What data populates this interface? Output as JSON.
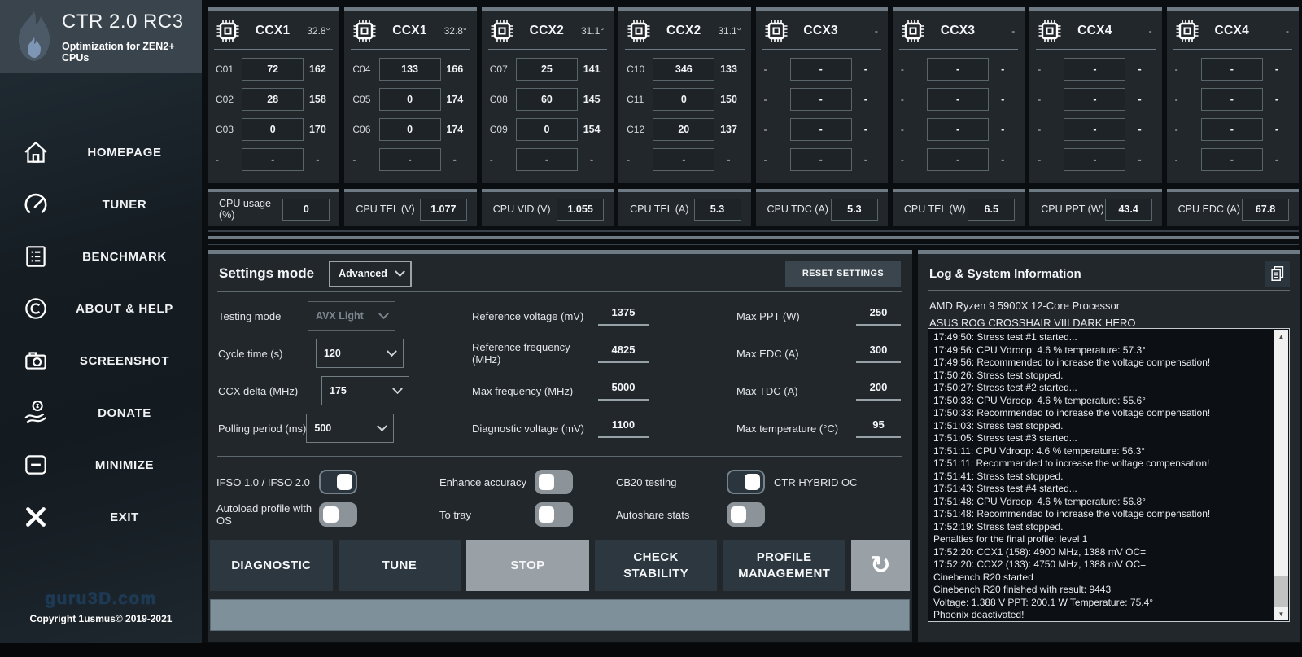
{
  "app": {
    "title": "CTR 2.0 RC3",
    "subtitle": "Optimization for ZEN2+ CPUs",
    "watermark": "guru3D.com",
    "copyright": "Copyright 1usmus© 2019-2021"
  },
  "sidebar": {
    "items": [
      {
        "label": "HOMEPAGE",
        "icon": "home-icon"
      },
      {
        "label": "TUNER",
        "icon": "gauge-icon"
      },
      {
        "label": "BENCHMARK",
        "icon": "list-icon"
      },
      {
        "label": "ABOUT & HELP",
        "icon": "copyright-icon"
      },
      {
        "label": "SCREENSHOT",
        "icon": "camera-icon"
      },
      {
        "label": "DONATE",
        "icon": "donate-hand-icon"
      },
      {
        "label": "MINIMIZE",
        "icon": "minimize-icon"
      },
      {
        "label": "EXIT",
        "icon": "close-icon"
      }
    ]
  },
  "ccx_panels": [
    {
      "name": "CCX1",
      "temp": "32.8°",
      "rows": [
        {
          "core": "C01",
          "value": "72",
          "right": "162"
        },
        {
          "core": "C02",
          "value": "28",
          "right": "158"
        },
        {
          "core": "C03",
          "value": "0",
          "right": "170"
        },
        {
          "core": "-",
          "value": "-",
          "right": "-"
        }
      ]
    },
    {
      "name": "CCX1",
      "temp": "32.8°",
      "rows": [
        {
          "core": "C04",
          "value": "133",
          "right": "166"
        },
        {
          "core": "C05",
          "value": "0",
          "right": "174"
        },
        {
          "core": "C06",
          "value": "0",
          "right": "174"
        },
        {
          "core": "-",
          "value": "-",
          "right": "-"
        }
      ]
    },
    {
      "name": "CCX2",
      "temp": "31.1°",
      "rows": [
        {
          "core": "C07",
          "value": "25",
          "right": "141"
        },
        {
          "core": "C08",
          "value": "60",
          "right": "145"
        },
        {
          "core": "C09",
          "value": "0",
          "right": "154"
        },
        {
          "core": "-",
          "value": "-",
          "right": "-"
        }
      ]
    },
    {
      "name": "CCX2",
      "temp": "31.1°",
      "rows": [
        {
          "core": "C10",
          "value": "346",
          "right": "133"
        },
        {
          "core": "C11",
          "value": "0",
          "right": "150"
        },
        {
          "core": "C12",
          "value": "20",
          "right": "137"
        },
        {
          "core": "-",
          "value": "-",
          "right": "-"
        }
      ]
    },
    {
      "name": "CCX3",
      "temp": "-",
      "rows": [
        {
          "core": "-",
          "value": "-",
          "right": "-"
        },
        {
          "core": "-",
          "value": "-",
          "right": "-"
        },
        {
          "core": "-",
          "value": "-",
          "right": "-"
        },
        {
          "core": "-",
          "value": "-",
          "right": "-"
        }
      ]
    },
    {
      "name": "CCX3",
      "temp": "-",
      "rows": [
        {
          "core": "-",
          "value": "-",
          "right": "-"
        },
        {
          "core": "-",
          "value": "-",
          "right": "-"
        },
        {
          "core": "-",
          "value": "-",
          "right": "-"
        },
        {
          "core": "-",
          "value": "-",
          "right": "-"
        }
      ]
    },
    {
      "name": "CCX4",
      "temp": "-",
      "rows": [
        {
          "core": "-",
          "value": "-",
          "right": "-"
        },
        {
          "core": "-",
          "value": "-",
          "right": "-"
        },
        {
          "core": "-",
          "value": "-",
          "right": "-"
        },
        {
          "core": "-",
          "value": "-",
          "right": "-"
        }
      ]
    },
    {
      "name": "CCX4",
      "temp": "-",
      "rows": [
        {
          "core": "-",
          "value": "-",
          "right": "-"
        },
        {
          "core": "-",
          "value": "-",
          "right": "-"
        },
        {
          "core": "-",
          "value": "-",
          "right": "-"
        },
        {
          "core": "-",
          "value": "-",
          "right": "-"
        }
      ]
    }
  ],
  "cpu_stats": [
    {
      "label": "CPU usage (%)",
      "value": "0"
    },
    {
      "label": "CPU TEL (V)",
      "value": "1.077"
    },
    {
      "label": "CPU VID (V)",
      "value": "1.055"
    },
    {
      "label": "CPU TEL (A)",
      "value": "5.3"
    },
    {
      "label": "CPU TDC (A)",
      "value": "5.3"
    },
    {
      "label": "CPU TEL (W)",
      "value": "6.5"
    },
    {
      "label": "CPU PPT (W)",
      "value": "43.4"
    },
    {
      "label": "CPU EDC (A)",
      "value": "67.8"
    }
  ],
  "settings": {
    "title": "Settings mode",
    "mode_value": "Advanced",
    "reset_label": "RESET SETTINGS",
    "dropdown_rows": [
      {
        "label": "Testing mode",
        "value": "AVX Light",
        "disabled": true
      },
      {
        "label": "Cycle time (s)",
        "value": "120",
        "disabled": false
      },
      {
        "label": "CCX delta (MHz)",
        "value": "175",
        "disabled": false
      },
      {
        "label": "Polling period (ms)",
        "value": "500",
        "disabled": false
      }
    ],
    "mid_fields": [
      {
        "label": "Reference voltage (mV)",
        "value": "1375"
      },
      {
        "label": "Reference frequency (MHz)",
        "value": "4825"
      },
      {
        "label": "Max frequency (MHz)",
        "value": "5000"
      },
      {
        "label": "Diagnostic voltage (mV)",
        "value": "1100"
      }
    ],
    "right_fields": [
      {
        "label": "Max PPT (W)",
        "value": "250"
      },
      {
        "label": "Max EDC (A)",
        "value": "300"
      },
      {
        "label": "Max TDC (A)",
        "value": "200"
      },
      {
        "label": "Max temperature (°C)",
        "value": "95"
      }
    ],
    "toggles": [
      {
        "label": "IFSO 1.0 / IFSO 2.0",
        "on": true
      },
      {
        "label": "Enhance accuracy",
        "on": false
      },
      {
        "label": "CB20 testing",
        "on": true
      },
      {
        "label": "CTR HYBRID OC",
        "on": false
      },
      {
        "label": "Autoload profile with OS",
        "on": false
      },
      {
        "label": "To tray",
        "on": false
      },
      {
        "label": "Autoshare stats",
        "on": false
      }
    ],
    "buttons": [
      {
        "label": "DIAGNOSTIC",
        "active": false
      },
      {
        "label": "TUNE",
        "active": false
      },
      {
        "label": "STOP",
        "active": true
      },
      {
        "label": "CHECK STABILITY",
        "active": false
      },
      {
        "label": "PROFILE MANAGEMENT",
        "active": false
      }
    ],
    "refresh_glyph": "↻"
  },
  "log": {
    "title": "Log & System Information",
    "system_lines": [
      {
        "text": "AMD Ryzen 9 5900X 12-Core Processor"
      },
      {
        "text": "ASUS ROG CROSSHAIR VIII DARK HERO"
      }
    ],
    "lines": [
      {
        "text": "17:49:50: Stress test #1 started..."
      },
      {
        "text": "17:49:56: CPU Vdroop: 4.6 % temperature: 57.3°"
      },
      {
        "text": "17:49:56: Recommended to increase the voltage compensation!"
      },
      {
        "text": "17:50:26: Stress test stopped."
      },
      {
        "text": "17:50:27: Stress test #2 started..."
      },
      {
        "text": "17:50:33: CPU Vdroop: 4.6 % temperature: 55.6°"
      },
      {
        "text": "17:50:33: Recommended to increase the voltage compensation!"
      },
      {
        "text": "17:51:03: Stress test stopped."
      },
      {
        "text": "17:51:05: Stress test #3 started..."
      },
      {
        "text": "17:51:11: CPU Vdroop: 4.6 % temperature: 56.3°"
      },
      {
        "text": "17:51:11: Recommended to increase the voltage compensation!"
      },
      {
        "text": "17:51:41: Stress test stopped."
      },
      {
        "text": "17:51:43: Stress test #4 started..."
      },
      {
        "text": "17:51:48: CPU Vdroop: 4.6 % temperature: 56.8°"
      },
      {
        "text": "17:51:48: Recommended to increase the voltage compensation!"
      },
      {
        "text": "17:52:19: Stress test stopped."
      },
      {
        "text": "Penalties for the final profile: level 1"
      },
      {
        "text": "17:52:20: CCX1 (158): 4900 MHz, 1388 mV  OC="
      },
      {
        "text": "17:52:20: CCX2 (133): 4750 MHz, 1388 mV  OC="
      },
      {
        "text": "Cinebench R20 started"
      },
      {
        "text": "Cinebench R20 finished with result: 9443"
      },
      {
        "text": "Voltage: 1.388 V  PPT: 200.1 W  Temperature: 75.4°"
      },
      {
        "text": "Phoenix deactivated!"
      }
    ]
  },
  "colors": {
    "background": "#0b0e11",
    "panel": "#22272c",
    "accent_strip": "#6e7b84",
    "sidebar_header": "#39444c",
    "active_button": "#9aa1a6",
    "progress": "#7e909a",
    "log_background": "#0c1014",
    "text": "#f4f6f7"
  }
}
